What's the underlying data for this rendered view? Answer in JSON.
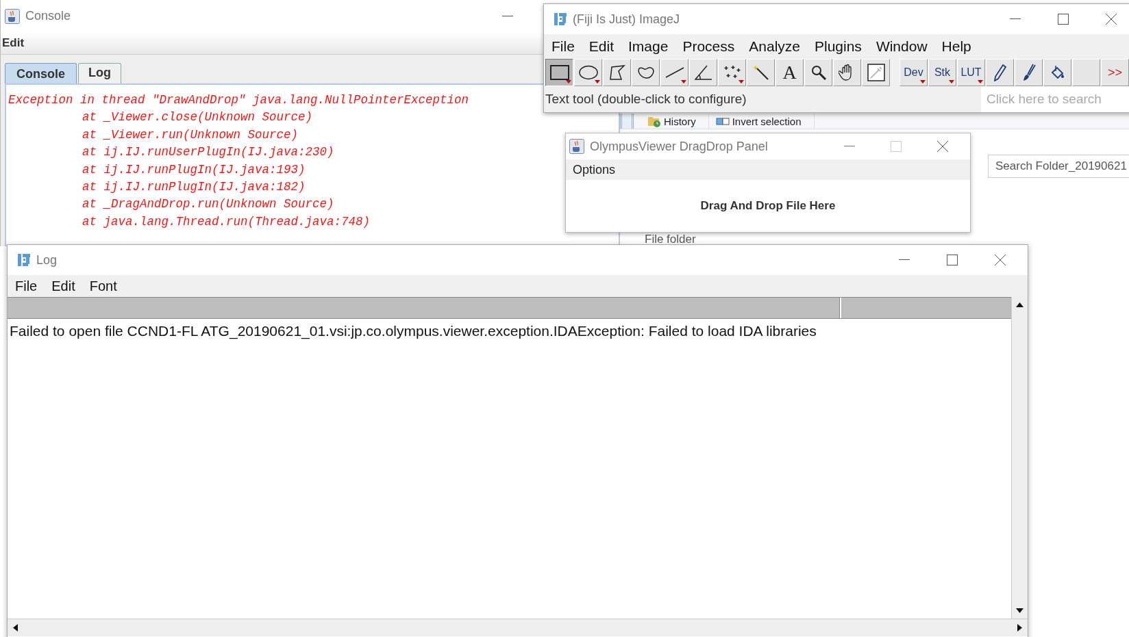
{
  "console_window": {
    "title": "Console",
    "menu": [
      "Edit"
    ],
    "tabs": [
      {
        "label": "Console",
        "selected": true
      },
      {
        "label": "Log",
        "selected": false
      }
    ],
    "lines": [
      {
        "kind": "head",
        "text": "Exception in thread \"DrawAndDrop\" java.lang.NullPointerException"
      },
      {
        "kind": "frame",
        "text": "at _Viewer.close(Unknown Source)"
      },
      {
        "kind": "frame",
        "text": "at _Viewer.run(Unknown Source)"
      },
      {
        "kind": "frame",
        "text": "at ij.IJ.runUserPlugIn(IJ.java:230)"
      },
      {
        "kind": "frame",
        "text": "at ij.IJ.runPlugIn(IJ.java:193)"
      },
      {
        "kind": "frame",
        "text": "at ij.IJ.runPlugIn(IJ.java:182)"
      },
      {
        "kind": "frame",
        "text": "at _DragAndDrop.run(Unknown Source)"
      },
      {
        "kind": "frame",
        "text": "at java.lang.Thread.run(Thread.java:748)"
      }
    ]
  },
  "explorer_window": {
    "ribbon": [
      {
        "kind": "history",
        "label": "History"
      },
      {
        "kind": "invert",
        "label": "Invert selection"
      }
    ],
    "search": {
      "placeholder": "Search Folder_20190621"
    },
    "row_type": "File folder"
  },
  "imagej_window": {
    "title": "(Fiji Is Just) ImageJ",
    "menu": [
      "File",
      "Edit",
      "Image",
      "Process",
      "Analyze",
      "Plugins",
      "Window",
      "Help"
    ],
    "tools": [
      {
        "kind": "rectangle",
        "selected": true,
        "dropdown": true
      },
      {
        "kind": "oval",
        "selected": false,
        "dropdown": true
      },
      {
        "kind": "polygon",
        "selected": false,
        "dropdown": false
      },
      {
        "kind": "freehand",
        "selected": false,
        "dropdown": false
      },
      {
        "kind": "line",
        "selected": false,
        "dropdown": true
      },
      {
        "kind": "angle",
        "selected": false,
        "dropdown": false
      },
      {
        "kind": "multipoint",
        "selected": false,
        "dropdown": true
      },
      {
        "kind": "wand",
        "selected": false,
        "dropdown": false
      },
      {
        "kind": "label",
        "label": "A",
        "selected": false,
        "dropdown": false
      },
      {
        "kind": "magnifier",
        "selected": false,
        "dropdown": false
      },
      {
        "kind": "hand",
        "selected": false,
        "dropdown": false
      },
      {
        "kind": "dropper",
        "selected": false,
        "dropdown": false
      },
      {
        "kind": "gap"
      },
      {
        "kind": "label",
        "label": "Dev",
        "selected": false,
        "dropdown": true
      },
      {
        "kind": "label",
        "label": "Stk",
        "selected": false,
        "dropdown": true
      },
      {
        "kind": "label",
        "label": "LUT",
        "selected": false,
        "dropdown": true
      },
      {
        "kind": "pen",
        "selected": false,
        "dropdown": false
      },
      {
        "kind": "brush",
        "selected": false,
        "dropdown": false
      },
      {
        "kind": "bucket",
        "selected": false,
        "dropdown": false
      },
      {
        "kind": "empty",
        "selected": false,
        "dropdown": false
      },
      {
        "kind": "more",
        "label": ">>",
        "selected": false,
        "dropdown": false
      }
    ],
    "status": "Text tool (double-click to configure)",
    "search": {
      "placeholder": "Click here to search"
    }
  },
  "panel_window": {
    "title": "OlympusViewer DragDrop Panel",
    "menu": [
      "Options"
    ],
    "message": "Drag And Drop File Here"
  },
  "log_window": {
    "title": "Log",
    "menu": [
      "File",
      "Edit",
      "Font"
    ],
    "lines": [
      "Failed to open file CCND1-FL ATG_20190621_01.vsi:jp.co.olympus.viewer.exception.IDAException: Failed to load IDA libraries"
    ]
  }
}
